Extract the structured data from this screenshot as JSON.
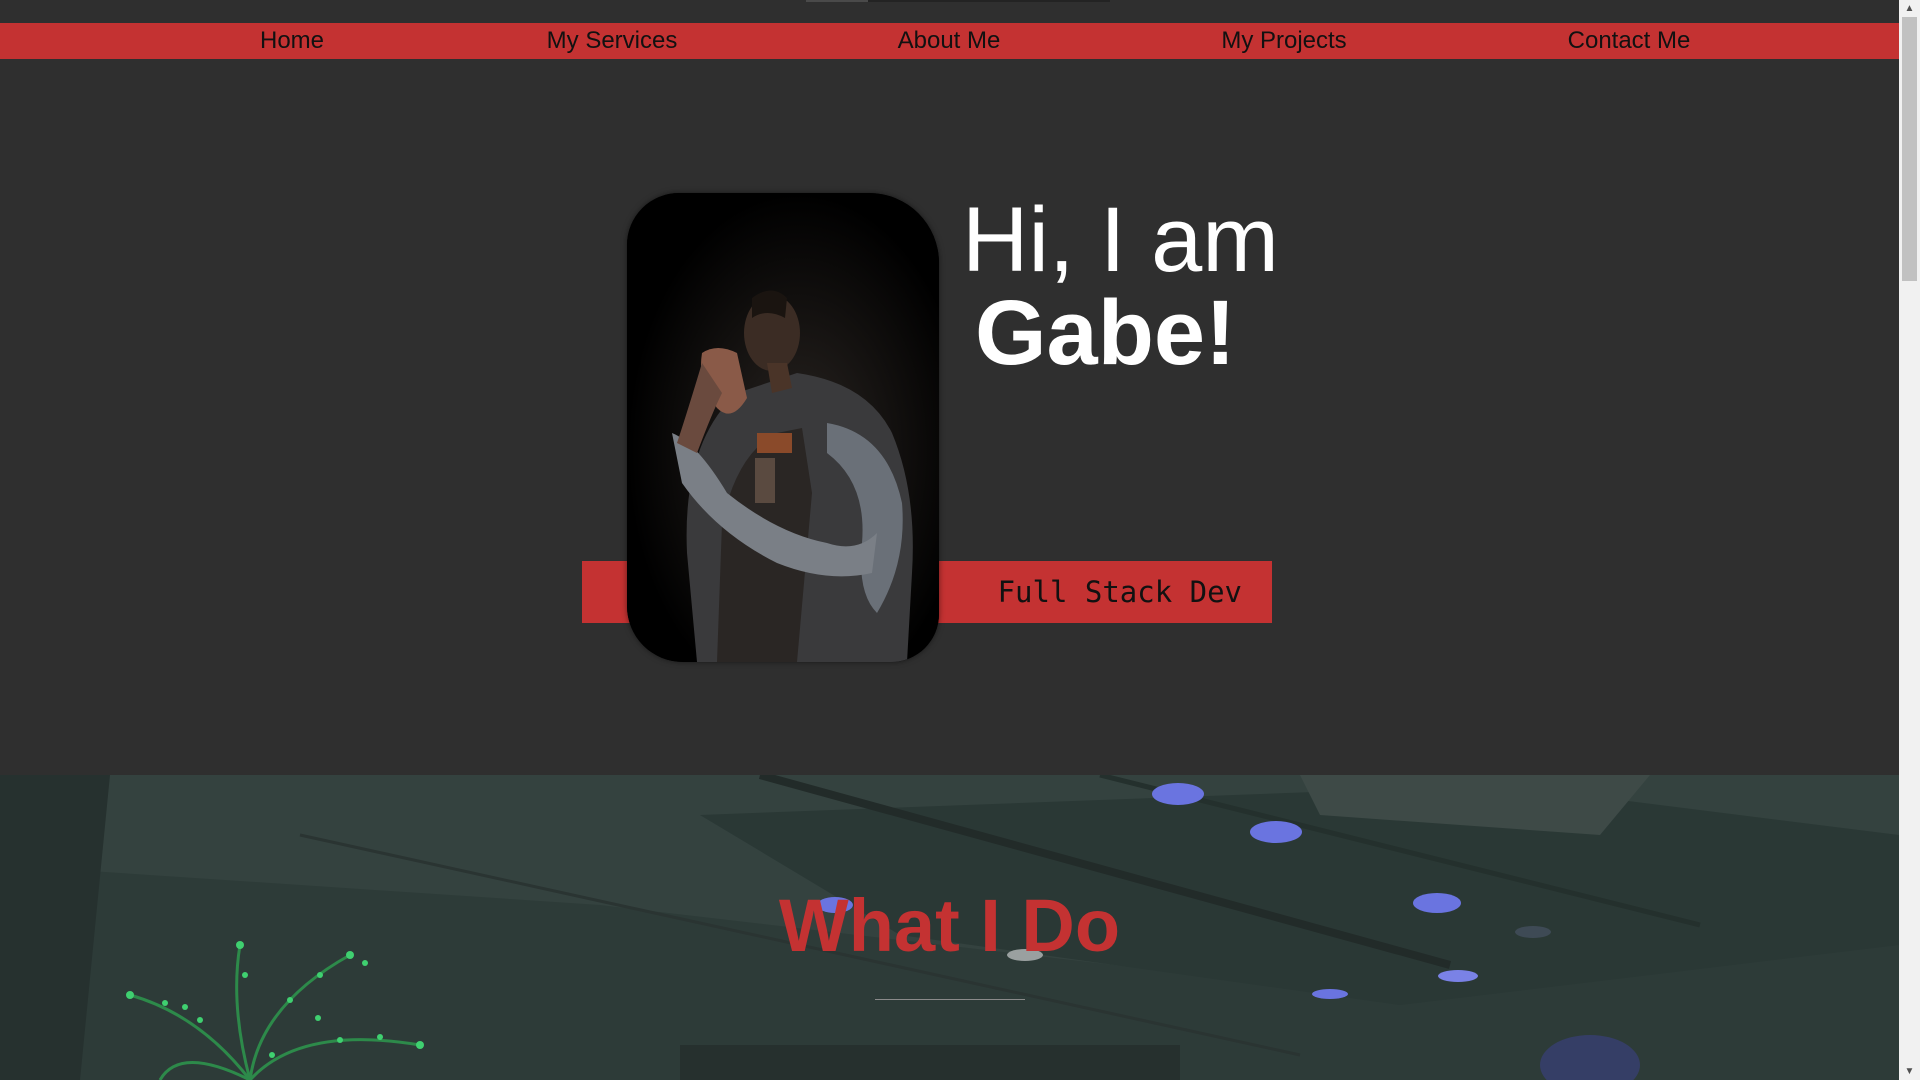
{
  "nav": {
    "items": [
      {
        "label": "Home"
      },
      {
        "label": "My Services"
      },
      {
        "label": "About Me"
      },
      {
        "label": "My Projects"
      },
      {
        "label": "Contact Me"
      }
    ]
  },
  "hero": {
    "greeting": "Hi, I am",
    "name": "Gabe!",
    "role": "Full Stack Dev"
  },
  "services": {
    "title": "What I Do"
  },
  "colors": {
    "accent": "#c43232",
    "background": "#2f2f2f",
    "text": "#ffffff"
  },
  "scrollbar": {
    "up_icon": "▲",
    "down_icon": "▼"
  }
}
